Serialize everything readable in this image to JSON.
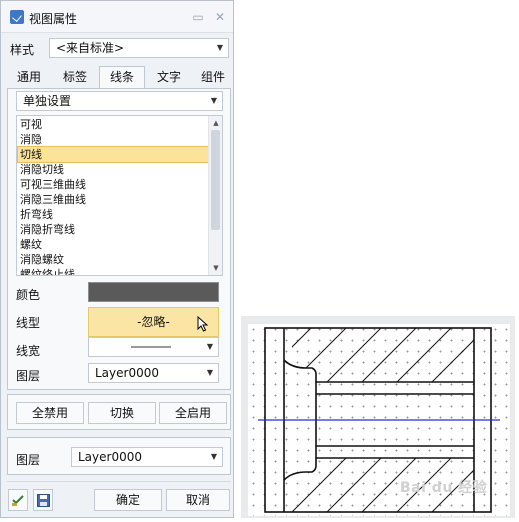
{
  "window": {
    "title": "视图属性"
  },
  "style_row": {
    "label": "样式",
    "value": "<来自标准>"
  },
  "tabs": [
    {
      "label": "通用"
    },
    {
      "label": "标签"
    },
    {
      "label": "线条",
      "active": true
    },
    {
      "label": "文字"
    },
    {
      "label": "组件"
    }
  ],
  "line_mode": {
    "value": "单独设置"
  },
  "line_list": {
    "items": [
      "可视",
      "消隐",
      "切线",
      "消隐切线",
      "可视三维曲线",
      "消隐三维曲线",
      "折弯线",
      "消隐折弯线",
      "螺纹",
      "消隐螺纹",
      "螺纹终止线"
    ],
    "selected_index": 2
  },
  "props": {
    "color_label": "颜色",
    "color_value": "#5a5a5a",
    "linetype_label": "线型",
    "linetype_value": "-忽略-",
    "linewidth_label": "线宽",
    "layer_label": "图层",
    "layer_value": "Layer0000"
  },
  "toggle_buttons": {
    "disable_all": "全禁用",
    "toggle": "切换",
    "enable_all": "全启用"
  },
  "layer_group": {
    "label": "图层",
    "value": "Layer0000"
  },
  "footer": {
    "ok": "确定",
    "cancel": "取消"
  },
  "drawing": {
    "center_line_color": "#2b2bd6"
  },
  "watermark": "Bai du 经验"
}
